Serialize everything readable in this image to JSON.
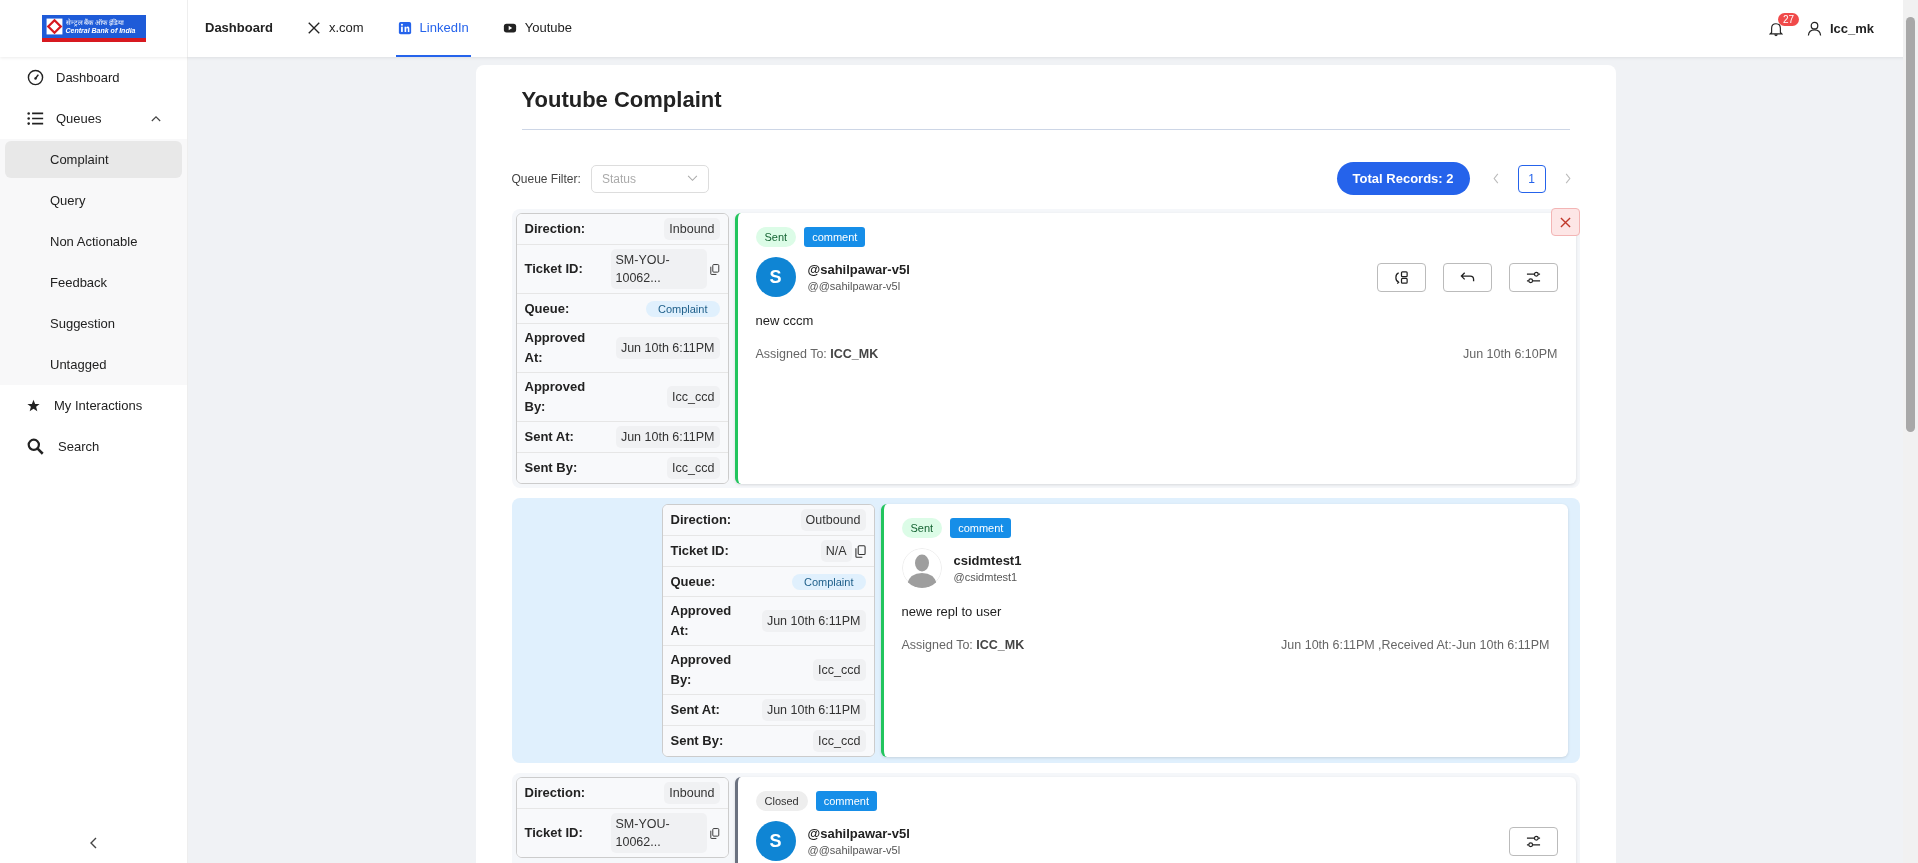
{
  "logo": {
    "hindi": "सेन्ट्रल बैंक ऑफ इंडिया",
    "english": "Central Bank of India"
  },
  "top_nav": [
    {
      "label": "Dashboard",
      "selected": false
    },
    {
      "label": "x.com",
      "selected": false
    },
    {
      "label": "LinkedIn",
      "selected": true
    },
    {
      "label": "Youtube",
      "selected": false
    }
  ],
  "notifications": {
    "count": "27"
  },
  "user": {
    "name": "Icc_mk"
  },
  "sidebar": {
    "items": [
      {
        "label": "Dashboard"
      },
      {
        "label": "Queues",
        "expanded": true,
        "children": [
          {
            "label": "Complaint",
            "selected": true
          },
          {
            "label": "Query",
            "selected": false
          },
          {
            "label": "Non Actionable",
            "selected": false
          },
          {
            "label": "Feedback",
            "selected": false
          },
          {
            "label": "Suggestion",
            "selected": false
          },
          {
            "label": "Untagged",
            "selected": false
          }
        ]
      },
      {
        "label": "My Interactions"
      },
      {
        "label": "Search"
      }
    ]
  },
  "page": {
    "title": "Youtube Complaint",
    "filter_label": "Queue Filter:",
    "filter_placeholder": "Status",
    "total_records": "Total Records: 2",
    "pages": [
      {
        "label": "1",
        "selected": true
      }
    ]
  },
  "threads": [
    {
      "reply": false,
      "dismissable": true,
      "details": [
        {
          "label": "Direction:",
          "value": "Inbound",
          "kind": "text"
        },
        {
          "label": "Ticket ID:",
          "value": "SM-YOU-10062...",
          "kind": "copy"
        },
        {
          "label": "Queue:",
          "value": "Complaint",
          "kind": "badge"
        },
        {
          "label": "Approved At:",
          "value": "Jun 10th 6:11PM",
          "kind": "text"
        },
        {
          "label": "Approved By:",
          "value": "Icc_ccd",
          "kind": "text"
        },
        {
          "label": "Sent At:",
          "value": "Jun 10th 6:11PM",
          "kind": "text"
        },
        {
          "label": "Sent By:",
          "value": "Icc_ccd",
          "kind": "text"
        }
      ],
      "status": {
        "label": "Sent",
        "kind": "sent"
      },
      "tag": "comment",
      "avatar": {
        "kind": "initial",
        "letter": "S"
      },
      "author": "@sahilpawar-v5l",
      "handle": "@@sahilpawar-v5l",
      "message": "new cccm",
      "assigned_label": "Assigned To:",
      "assigned_to": "ICC_MK",
      "timestamp": "Jun 10th 6:10PM",
      "actions": [
        {
          "kind": "convert"
        },
        {
          "kind": "reply"
        },
        {
          "kind": "settings"
        }
      ]
    },
    {
      "reply": true,
      "dismissable": false,
      "details": [
        {
          "label": "Direction:",
          "value": "Outbound",
          "kind": "text"
        },
        {
          "label": "Ticket ID:",
          "value": "N/A",
          "kind": "copy"
        },
        {
          "label": "Queue:",
          "value": "Complaint",
          "kind": "badge"
        },
        {
          "label": "Approved At:",
          "value": "Jun 10th 6:11PM",
          "kind": "text"
        },
        {
          "label": "Approved By:",
          "value": "Icc_ccd",
          "kind": "text"
        },
        {
          "label": "Sent At:",
          "value": "Jun 10th 6:11PM",
          "kind": "text"
        },
        {
          "label": "Sent By:",
          "value": "Icc_ccd",
          "kind": "text"
        }
      ],
      "status": {
        "label": "Sent",
        "kind": "sent"
      },
      "tag": "comment",
      "avatar": {
        "kind": "silhouette"
      },
      "author": "csidmtest1",
      "handle": "@csidmtest1",
      "message": "newe repl to user",
      "assigned_label": "Assigned To:",
      "assigned_to": "ICC_MK",
      "timestamp": "Jun 10th 6:11PM ,Received At:-Jun 10th 6:11PM"
    },
    {
      "reply": false,
      "dismissable": false,
      "details": [
        {
          "label": "Direction:",
          "value": "Inbound",
          "kind": "text"
        },
        {
          "label": "Ticket ID:",
          "value": "SM-YOU-10062...",
          "kind": "copy"
        }
      ],
      "status": {
        "label": "Closed",
        "kind": "closed"
      },
      "tag": "comment",
      "avatar": {
        "kind": "initial",
        "letter": "S"
      },
      "author": "@sahilpawar-v5l",
      "handle": "@@sahilpawar-v5l",
      "actions": [
        {
          "kind": "settings"
        }
      ]
    }
  ]
}
